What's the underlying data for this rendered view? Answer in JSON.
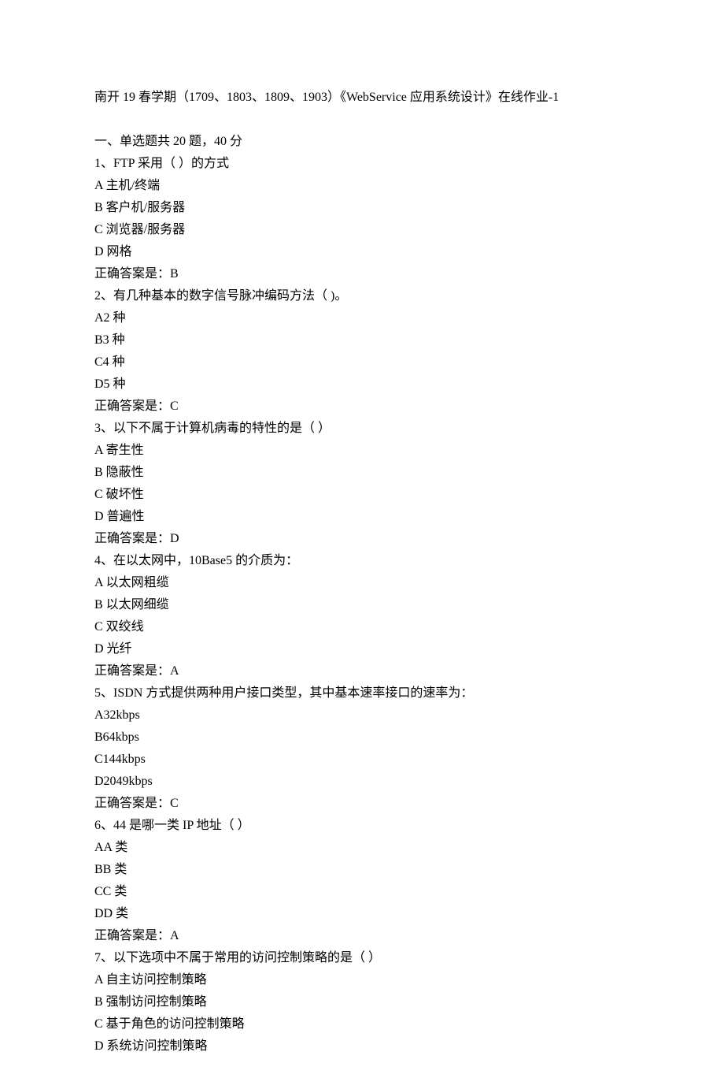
{
  "title": "南开 19 春学期（1709、1803、1809、1903）《WebService 应用系统设计》在线作业-1",
  "section_header": "一、单选题共 20 题，40 分",
  "questions": [
    {
      "q": "1、FTP 采用（ ）的方式",
      "opts": [
        "A 主机/终端",
        "B 客户机/服务器",
        "C 浏览器/服务器",
        "D 网格"
      ],
      "ans": "正确答案是：B"
    },
    {
      "q": "2、有几种基本的数字信号脉冲编码方法（ )。",
      "opts": [
        "A2 种",
        "B3 种",
        "C4 种",
        "D5 种"
      ],
      "ans": "正确答案是：C"
    },
    {
      "q": "3、以下不属于计算机病毒的特性的是（ ）",
      "opts": [
        "A 寄生性",
        "B 隐蔽性",
        "C 破坏性",
        "D 普遍性"
      ],
      "ans": "正确答案是：D"
    },
    {
      "q": "4、在以太网中，10Base5 的介质为：",
      "opts": [
        "A 以太网粗缆",
        "B 以太网细缆",
        "C 双绞线",
        "D 光纤"
      ],
      "ans": "正确答案是：A"
    },
    {
      "q": "5、ISDN 方式提供两种用户接口类型，其中基本速率接口的速率为：",
      "opts": [
        "A32kbps",
        "B64kbps",
        "C144kbps",
        "D2049kbps"
      ],
      "ans": "正确答案是：C"
    },
    {
      "q": "6、44 是哪一类 IP 地址（ ）",
      "opts": [
        "AA 类",
        "BB 类",
        "CC 类",
        "DD 类"
      ],
      "ans": "正确答案是：A"
    },
    {
      "q": "7、以下选项中不属于常用的访问控制策略的是（ ）",
      "opts": [
        "A 自主访问控制策略",
        "B 强制访问控制策略",
        "C 基于角色的访问控制策略",
        "D 系统访问控制策略"
      ],
      "ans": null
    }
  ]
}
